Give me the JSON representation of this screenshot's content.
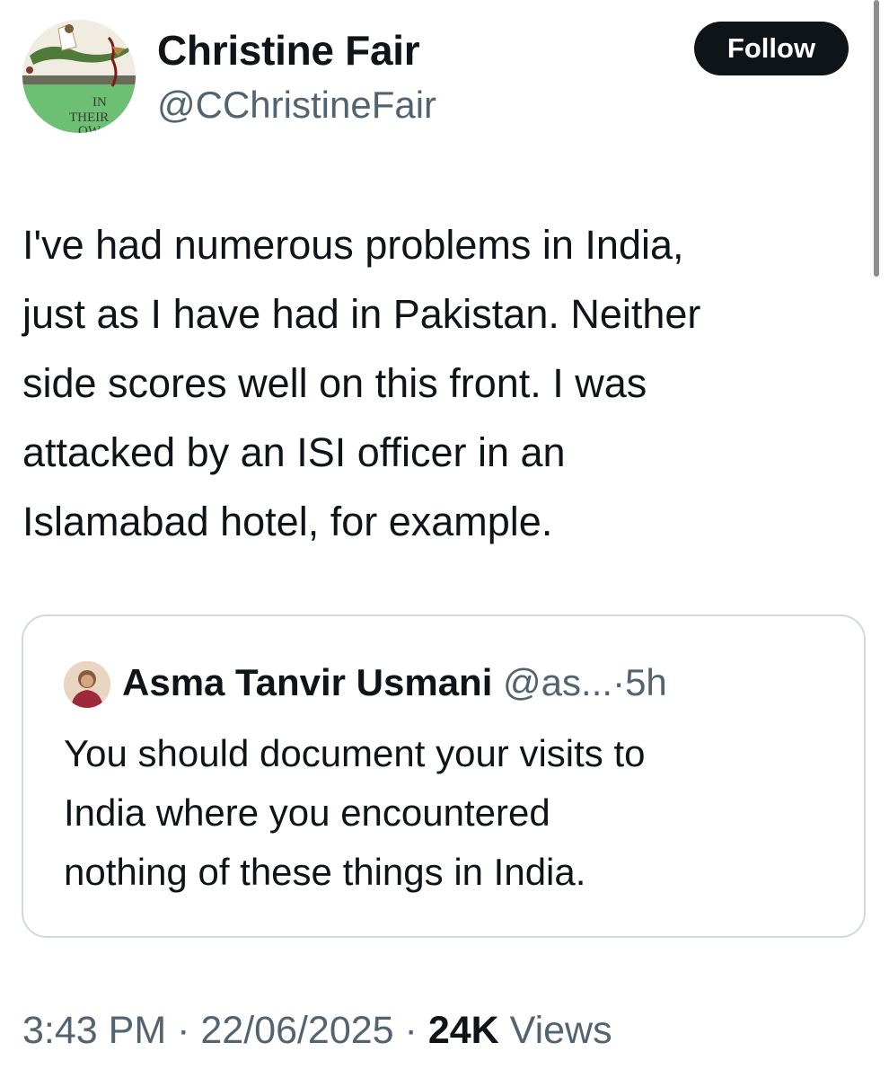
{
  "author": {
    "name": "Christine Fair",
    "handle": "@CChristineFair",
    "avatar_icon": "book-cover-avatar",
    "avatar_text_lines": [
      "IN",
      "THEIR",
      "OW"
    ]
  },
  "follow_button": {
    "label": "Follow"
  },
  "tweet": {
    "lines": [
      "I've had numerous problems in India,",
      "just as I have had in Pakistan. Neither",
      "side scores well on this front. I was",
      "attacked by an ISI officer in an",
      "Islamabad hotel, for example."
    ]
  },
  "quoted_tweet": {
    "author_name": "Asma Tanvir Usmani",
    "handle_truncated": "@as...",
    "separator": "·",
    "time_ago": "5h",
    "lines": [
      "You should document your visits to",
      "India where you encountered",
      "nothing of these things in India."
    ]
  },
  "meta": {
    "time": "3:43 PM",
    "separator": "·",
    "date": "22/06/2025",
    "views_count": "24K",
    "views_label": "Views"
  },
  "colors": {
    "text_primary": "#0f1419",
    "text_secondary": "#536471",
    "border": "#cfd9de",
    "follow_bg": "#0f1419"
  }
}
